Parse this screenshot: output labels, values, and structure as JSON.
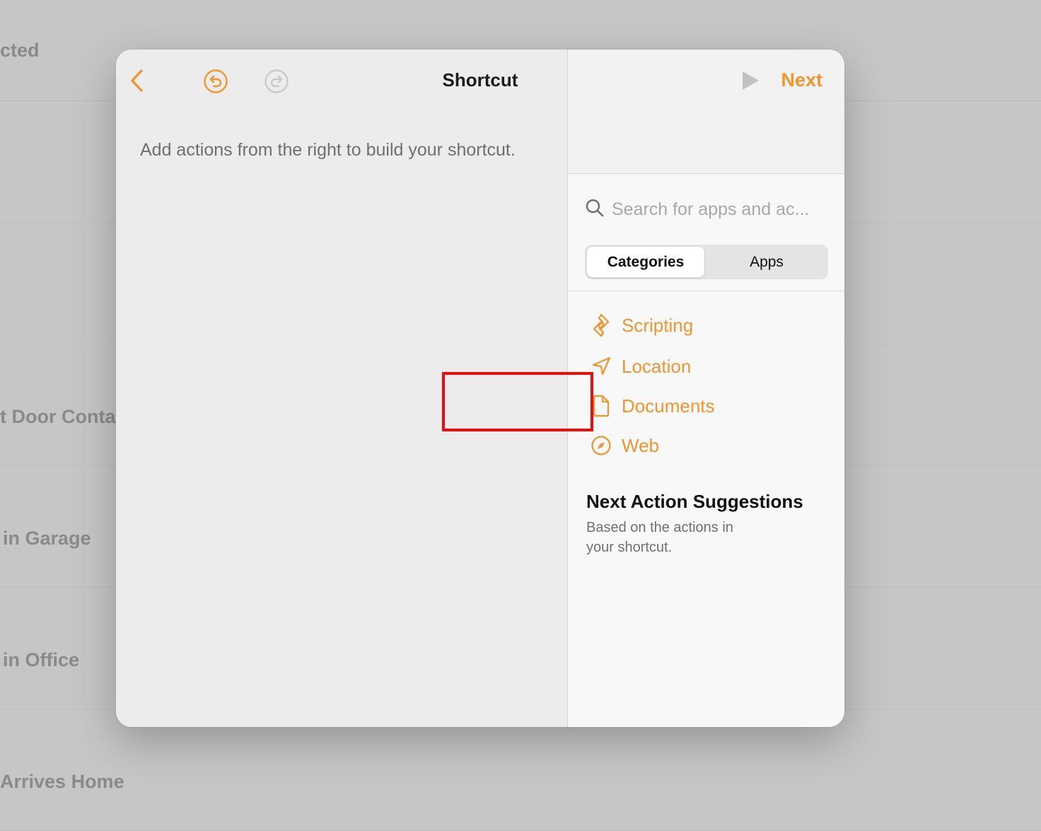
{
  "background": {
    "rows": [
      {
        "label": "cted"
      },
      {
        "label": ""
      },
      {
        "label": ""
      },
      {
        "label": "t Door Contac"
      },
      {
        "label": "in Garage"
      },
      {
        "label": "in Office"
      },
      {
        "label": "Arrives Home"
      }
    ]
  },
  "toolbar": {
    "back_icon": "chevron-left-icon",
    "undo_icon": "undo-icon",
    "redo_icon": "redo-icon",
    "title": "Shortcut",
    "play_icon": "play-icon",
    "next_label": "Next"
  },
  "editor": {
    "hint": "Add actions from the right to build your shortcut."
  },
  "library": {
    "search": {
      "placeholder": "Search for apps and ac..."
    },
    "segments": [
      {
        "label": "Categories",
        "selected": true
      },
      {
        "label": "Apps",
        "selected": false
      }
    ],
    "categories": [
      {
        "label": "Scripting",
        "icon": "scripting-icon"
      },
      {
        "label": "Location",
        "icon": "location-arrow-icon"
      },
      {
        "label": "Documents",
        "icon": "document-icon"
      },
      {
        "label": "Web",
        "icon": "compass-icon"
      }
    ],
    "suggestions": {
      "title": "Next Action Suggestions",
      "subtitle": "Based on the actions in your shortcut."
    }
  },
  "colors": {
    "accent": "#f0962c",
    "highlight": "#ee0c0c"
  }
}
